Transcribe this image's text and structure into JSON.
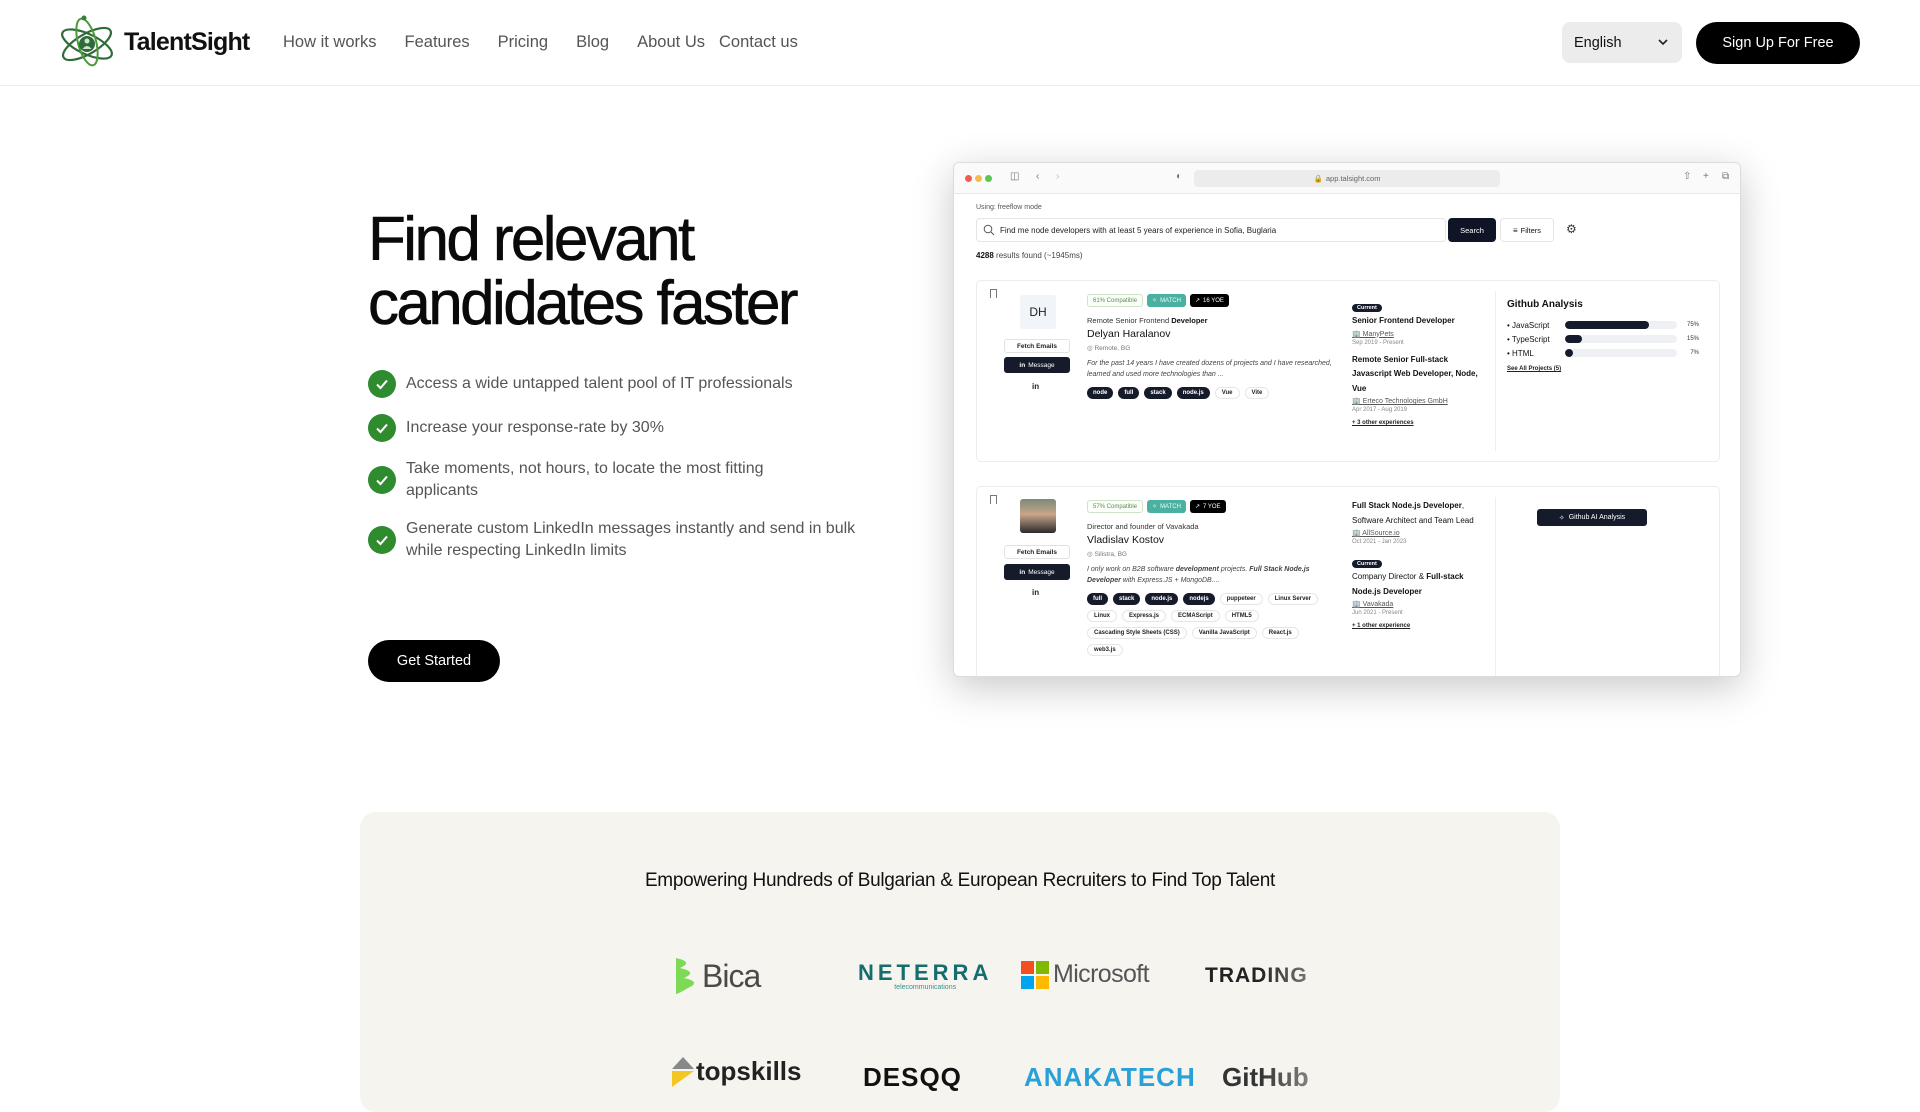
{
  "header": {
    "brand": "TalentSight",
    "nav": [
      "How it works",
      "Features",
      "Pricing",
      "Blog",
      "About Us",
      "Contact us"
    ],
    "language": "English",
    "signup_label": "Sign Up For Free"
  },
  "hero": {
    "title_line1": "Find relevant",
    "title_line2": "candidates faster",
    "features": [
      "Access a wide untapped talent pool of IT professionals",
      "Increase your response-rate by 30%",
      "Take moments, not hours, to locate the most fitting applicants",
      "Generate custom LinkedIn messages instantly and send in bulk while respecting LinkedIn limits"
    ],
    "cta_label": "Get Started",
    "accent_color": "#2e8b2e"
  },
  "app_preview": {
    "url": "app.talsight.com",
    "mode": "Using: freeflow mode",
    "search_query": "Find me node developers with at least 5 years of experience in Sofia, Buglaria",
    "search_label": "Search",
    "filters_label": "Filters",
    "results_count": "4288",
    "results_suffix": "results found (~1945ms)",
    "fetch_emails_label": "Fetch Emails",
    "message_label": "Message",
    "current_label": "Current",
    "candidates": [
      {
        "initials": "DH",
        "compatibility": "61% Compatible",
        "match": "MATCH",
        "yoe": "16 YOE",
        "role_prefix": "Remote Senior Frontend ",
        "role_bold": "Developer",
        "name": "Delyan Haralanov",
        "location": "Remote, BG",
        "bio": "For the past 14 years I have created dozens of projects and I have researched, learned and used more technologies than ...",
        "tags_dark": [
          "node",
          "full",
          "stack",
          "node.js"
        ],
        "tags_light": [
          "Vue",
          "Vite"
        ],
        "experiences": [
          {
            "current": true,
            "title": "Senior Frontend Developer",
            "company": "ManyPets",
            "dates": "Sep 2019 - Present"
          },
          {
            "current": false,
            "title": "Remote Senior Full-stack Javascript Web Developer, Node, Vue",
            "company": "Erteco Technologies GmbH",
            "dates": "Apr 2017 - Aug 2019"
          }
        ],
        "more_experiences": "+ 3 other experiences",
        "github": {
          "title": "Github Analysis",
          "languages": [
            {
              "name": "JavaScript",
              "percent": 75,
              "label": "75%"
            },
            {
              "name": "TypeScript",
              "percent": 15,
              "label": "15%"
            },
            {
              "name": "HTML",
              "percent": 7,
              "label": "7%"
            }
          ],
          "link": "See All Projects (5)"
        }
      },
      {
        "initials": "",
        "compatibility": "57% Compatible",
        "match": "MATCH",
        "yoe": "7 YOE",
        "role": "Director and founder of Vavakada",
        "name": "Vladislav Kostov",
        "location": "Silistra, BG",
        "bio_parts": [
          "I only work on B2B software ",
          "development",
          " projects. ",
          "Full Stack Node.js Developer",
          " with Express.JS + MongoDB...."
        ],
        "tags_dark": [
          "full",
          "stack",
          "node.js",
          "nodejs"
        ],
        "tags_light": [
          "puppeteer",
          "Linux Server",
          "Linux",
          "Express.js",
          "ECMAScript",
          "HTML5",
          "Cascading Style Sheets (CSS)",
          "Vanilla JavaScript",
          "React.js",
          "web3.js"
        ],
        "experiences": [
          {
            "current": false,
            "title_bold": "Full Stack Node.js Developer",
            "title_rest": ", Software Architect and Team Lead",
            "company": "AllSource.io",
            "dates": "Oct 2021 - Jan 2023"
          },
          {
            "current": true,
            "title_rest": "Company Director & ",
            "title_bold": "Full-stack Node.js Developer",
            "company": "Vavakada",
            "dates": "Jun 2021 - Present"
          }
        ],
        "more_experiences": "+ 1 other experience",
        "github_ai_label": "Github AI Analysis"
      }
    ]
  },
  "clients": {
    "title": "Empowering Hundreds of Bulgarian & European Recruiters to Find Top Talent",
    "row1": [
      "Bica",
      "NETERRA",
      "Microsoft",
      "TRADING"
    ],
    "row1_sub": "telecommunications",
    "row2": [
      "topskills",
      "DESQQ",
      "ANAKATECH",
      "GitHub"
    ]
  }
}
